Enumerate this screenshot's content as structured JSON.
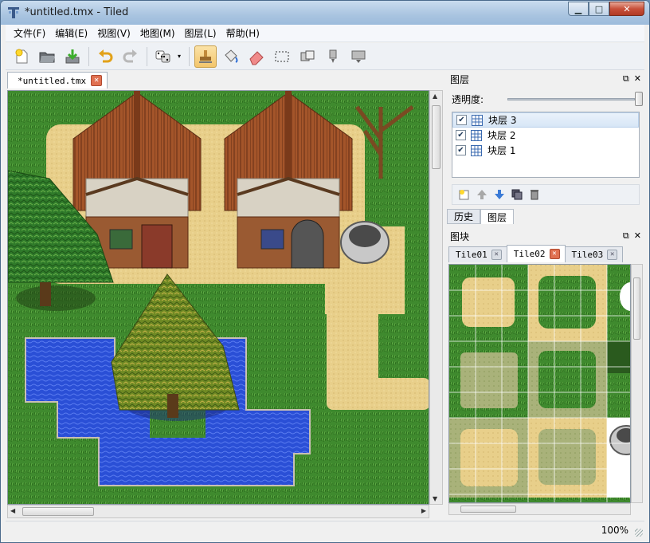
{
  "window": {
    "title": "*untitled.tmx - Tiled",
    "minimize_glyph": "▁",
    "maximize_glyph": "□",
    "close_glyph": "✕"
  },
  "menu": [
    "文件(F)",
    "编辑(E)",
    "视图(V)",
    "地图(M)",
    "图层(L)",
    "帮助(H)"
  ],
  "toolbar": {
    "icons": [
      "new-file-icon",
      "open-folder-icon",
      "save-icon",
      "undo-icon",
      "redo-icon",
      "random-mode-icon",
      "stamp-brush-icon",
      "bucket-fill-icon",
      "eraser-icon",
      "rect-select-icon",
      "select-same-tile-icon",
      "magic-wand-icon",
      "ellipse-select-icon"
    ],
    "active_tool": "stamp-brush-icon",
    "dropdown_glyph": "▾"
  },
  "document_tab": {
    "label": "*untitled.tmx",
    "close_glyph": "✕"
  },
  "map": {
    "colors": {
      "grass": "#3f8a2e",
      "sand": "#e8cf8a",
      "water": "#2a4fd6",
      "roof": "#a4552a",
      "wall": "#d8d2c4"
    }
  },
  "layers_panel": {
    "title": "图层",
    "opacity_label": "透明度:",
    "opacity_value": 1.0,
    "layers": [
      {
        "name": "块层 3",
        "visible": true,
        "selected": true
      },
      {
        "name": "块层 2",
        "visible": true,
        "selected": false
      },
      {
        "name": "块层 1",
        "visible": true,
        "selected": false
      }
    ],
    "check_glyph": "✔",
    "tool_icons": [
      "new-layer-icon",
      "move-layer-up-icon",
      "move-layer-down-icon",
      "duplicate-layer-icon",
      "delete-layer-icon"
    ],
    "tabs": [
      "历史",
      "图层"
    ],
    "active_tab": "图层",
    "float_glyph": "⧉",
    "close_glyph": "✕"
  },
  "tiles_panel": {
    "title": "图块",
    "tilesets": [
      {
        "name": "Tile01",
        "active": false
      },
      {
        "name": "Tile02",
        "active": true
      },
      {
        "name": "Tile03",
        "active": false
      }
    ],
    "tab_close_glyph": "✕",
    "float_glyph": "⧉",
    "close_glyph": "✕"
  },
  "scroll": {
    "up": "▲",
    "down": "▼",
    "left": "◀",
    "right": "▶",
    "grip": "|||"
  },
  "status": {
    "zoom": "100%"
  }
}
